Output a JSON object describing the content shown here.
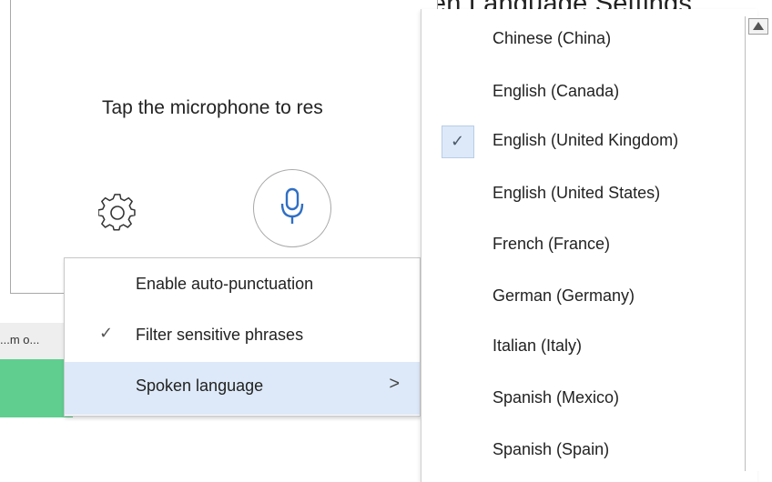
{
  "heading": {
    "text": "Using Microsoft Dictate Spoken Language Settings"
  },
  "dictation": {
    "prompt": "Tap the microphone to res",
    "gear_icon": "gear-icon",
    "mic_icon": "microphone-icon"
  },
  "background": {
    "strip_text": "...m o..."
  },
  "settings_menu": {
    "items": [
      {
        "label": "Enable auto-punctuation",
        "checked": false
      },
      {
        "label": "Filter sensitive phrases",
        "checked": true,
        "check_glyph": "✓"
      },
      {
        "label": "Spoken language",
        "has_submenu": true,
        "arrow": ">",
        "highlighted": true
      }
    ]
  },
  "language_menu": {
    "items": [
      {
        "label": "Chinese (China)"
      },
      {
        "label": "English (Canada)"
      },
      {
        "label": "English (United Kingdom)",
        "checked": true,
        "check_glyph": "✓"
      },
      {
        "label": "English (United States)"
      },
      {
        "label": "French (France)"
      },
      {
        "label": "German (Germany)"
      },
      {
        "label": "Italian (Italy)"
      },
      {
        "label": "Spanish (Mexico)"
      },
      {
        "label": "Spanish (Spain)"
      }
    ]
  },
  "colors": {
    "highlight": "#dde9f8",
    "mic_blue": "#2f6fc4",
    "strip_green": "#5fce8f"
  }
}
